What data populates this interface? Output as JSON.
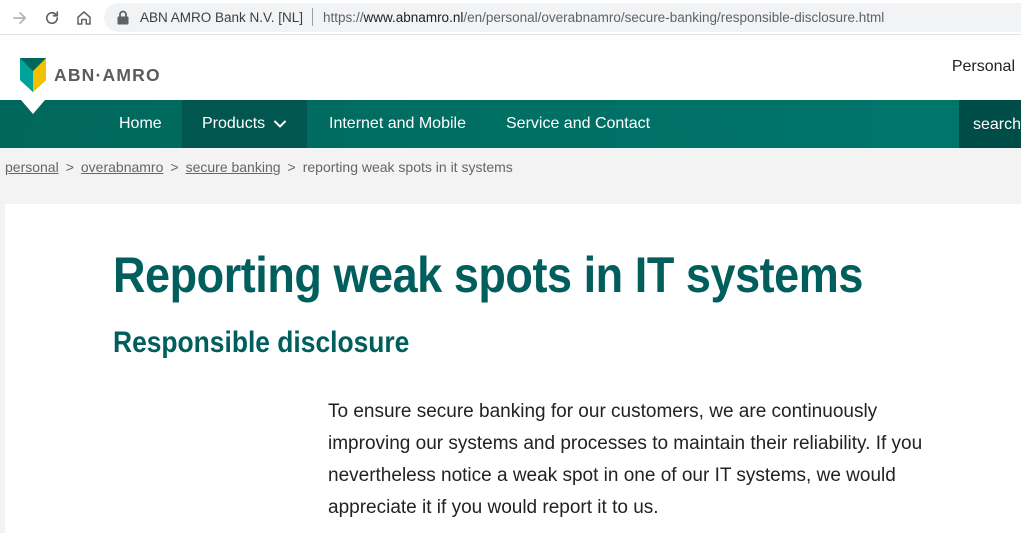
{
  "browser": {
    "site_identity": "ABN AMRO Bank N.V. [NL]",
    "url_scheme": "https://",
    "url_host": "www.abnamro.nl",
    "url_path": "/en/personal/overabnamro/secure-banking/responsible-disclosure.html",
    "icons": [
      "forward-icon",
      "reload-icon",
      "home-icon",
      "lock-icon"
    ]
  },
  "header": {
    "logo_text": "ABN·AMRO",
    "segment_link": "Personal"
  },
  "nav": {
    "items": [
      {
        "label": "Home"
      },
      {
        "label": "Products"
      },
      {
        "label": "Internet and Mobile"
      },
      {
        "label": "Service and Contact"
      }
    ],
    "search_label": "search"
  },
  "breadcrumb": {
    "items": [
      "personal",
      "overabnamro",
      "secure banking"
    ],
    "current": "reporting weak spots in it systems",
    "separator": ">"
  },
  "main": {
    "title": "Reporting weak spots in IT systems",
    "subtitle": "Responsible disclosure",
    "intro": "To ensure secure banking for our customers, we are continuously improving our systems and processes to maintain their reliability. If you nevertheless notice a weak spot in one of our IT systems, we would appreciate it if you would report it to us."
  },
  "colors": {
    "brand_green": "#00675c",
    "brand_dark_green": "#004d47",
    "heading_green": "#005e5d",
    "logo_yellow": "#f3c000"
  }
}
